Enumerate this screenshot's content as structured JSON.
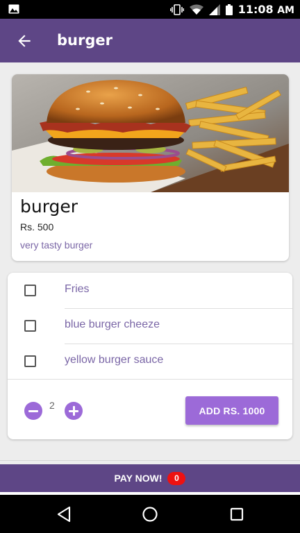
{
  "status_bar": {
    "time": "11:08",
    "ampm": "AM",
    "icons": [
      "image-icon",
      "vibrate-icon",
      "wifi-icon",
      "signal-icon",
      "battery-icon"
    ]
  },
  "app_bar": {
    "title": "burger",
    "back_icon": "arrow-back-icon",
    "color": "#5e4686"
  },
  "product": {
    "name": "burger",
    "price": "Rs. 500",
    "description": "very tasty burger"
  },
  "options": [
    {
      "label": "Fries",
      "checked": false
    },
    {
      "label": "blue burger cheeze",
      "checked": false
    },
    {
      "label": "yellow burger sauce",
      "checked": false
    }
  ],
  "quantity": {
    "value": "2",
    "minus_icon": "minus-circle-icon",
    "plus_icon": "plus-circle-icon"
  },
  "add_button": {
    "label": "ADD RS. 1000",
    "color": "#9c6ad8"
  },
  "pay_bar": {
    "label": "PAY NOW!",
    "badge": "0",
    "badge_color": "#ee1111"
  },
  "nav_bar": {
    "icons": [
      "back-triangle-icon",
      "home-circle-icon",
      "recents-square-icon"
    ]
  }
}
